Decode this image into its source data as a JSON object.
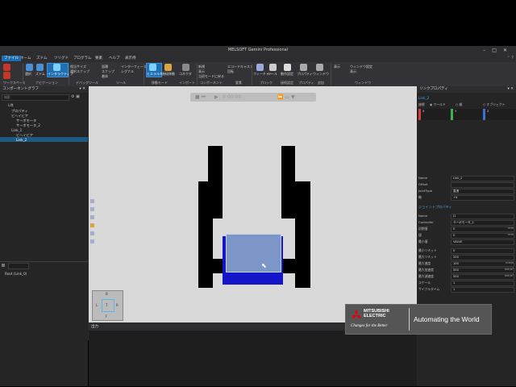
{
  "app": {
    "title": "MELSOFT Gemini Professional"
  },
  "menu": [
    "ファイル",
    "ホーム",
    "ズドム",
    "ツリグド",
    "プログラム",
    "要素",
    "ヘルプ",
    "表示待"
  ],
  "ribbon": {
    "items": [
      "選択",
      "ズドム",
      "移動",
      "インタラクティブ",
      "相当サイズ",
      "選択スナップ",
      "面積",
      "スナップ",
      "着体",
      "インターフェース",
      "シグナル",
      "ヒエラルキー",
      "直接移動",
      "コネクタ",
      "新規",
      "表示",
      "当初モードに戻る",
      "エコードキャスト",
      "回転",
      "フィーチャー",
      "ツール",
      "動作設定",
      "プロパティ",
      "ウィンドウ",
      "表示",
      "ウィンドウ設定",
      "表示"
    ],
    "groups": [
      "ワークスペース",
      "ナビゲーション",
      "デバッグツール",
      "ツール",
      "移動モード",
      "インポート",
      "コンポーネント",
      "要素",
      "ブロック",
      "接続設定",
      "プロパティ",
      "追加",
      "ウィンドウ"
    ]
  },
  "left_panel": {
    "title": "コンポーネントグラフ",
    "search_placeholder": "検索",
    "tree": [
      "Lift",
      "プロパティ",
      "ビヘイビア",
      "サーボモータ",
      "サーボモータ_2",
      "Link_1",
      "ビヘイビア",
      "Link_2"
    ],
    "bottom_tree": [
      "Root (Link_0)"
    ]
  },
  "viewport": {
    "time": "0:00:00",
    "nav_labels": [
      "B",
      "L",
      "T",
      "R",
      "F"
    ]
  },
  "output": {
    "title": "出力"
  },
  "props": {
    "title": "リンクプロパティ",
    "link_name": "Link_2",
    "coord_label": "座標",
    "coord_options": [
      "ワールド",
      "親",
      "オブジェクト"
    ],
    "xyz": [
      "X",
      "Y",
      "Z"
    ],
    "fields": [
      {
        "label": "Name",
        "value": "Link_2"
      },
      {
        "label": "Offset",
        "value": ""
      },
      {
        "label": "JointType",
        "value": "直進"
      },
      {
        "label": "軸",
        "value": "+X"
      }
    ],
    "joint_title": "ジョイントプロパティ",
    "joint_fields": [
      {
        "label": "Name",
        "value": "J1",
        "unit": ""
      },
      {
        "label": "Controller",
        "value": "サーボモータ_2",
        "unit": ""
      },
      {
        "label": "初期値",
        "value": "0",
        "unit": "mm"
      },
      {
        "label": "値",
        "value": "0",
        "unit": "mm"
      },
      {
        "label": "最小値",
        "value": "VALUE",
        "unit": ""
      },
      {
        "label": "最小リミット",
        "value": "0",
        "unit": ""
      },
      {
        "label": "最大リミット",
        "value": "200",
        "unit": ""
      },
      {
        "label": "最大速度",
        "value": "100",
        "unit": "mm/s"
      },
      {
        "label": "最大加速度",
        "value": "500",
        "unit": "mm/s²"
      },
      {
        "label": "最大減速度",
        "value": "500",
        "unit": "mm/s²"
      },
      {
        "label": "スケール",
        "value": "1",
        "unit": ""
      },
      {
        "label": "サイクルタイム",
        "value": "1",
        "unit": ""
      }
    ]
  },
  "branding": {
    "company": "MITSUBISHI ELECTRIC",
    "tagline": "Changes for the Better",
    "slogan": "Automating the World"
  },
  "colors": {
    "accent": "#1f6fb2",
    "lift_blue": "#1414c8",
    "view_bg": "#d9d9d9",
    "mitsubishi_red": "#e60012"
  }
}
